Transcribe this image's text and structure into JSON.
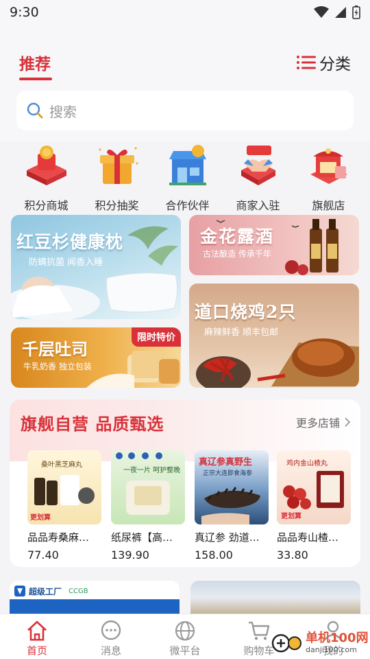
{
  "status_bar": {
    "time": "9:30"
  },
  "header": {
    "tab_label": "推荐",
    "category_label": "分类",
    "search_placeholder": "搜索"
  },
  "quick_links": [
    {
      "label": "积分商城",
      "icon": "coin-gift-icon"
    },
    {
      "label": "积分抽奖",
      "icon": "gift-box-icon"
    },
    {
      "label": "合作伙伴",
      "icon": "storefront-icon"
    },
    {
      "label": "商家入驻",
      "icon": "handshake-icon"
    },
    {
      "label": "旗舰店",
      "icon": "shop-bag-icon"
    }
  ],
  "banners": {
    "pillow": {
      "title": "红豆杉健康枕",
      "subtitle": "防螨抗菌  闻香入睡"
    },
    "wine": {
      "title": "金花露酒",
      "subtitle": "古法酿造  传承千年"
    },
    "toast": {
      "title": "千层吐司",
      "subtitle": "牛乳奶香  独立包装",
      "badge": "限时特价"
    },
    "chicken": {
      "title": "道口烧鸡2只",
      "subtitle": "麻辣鲜香  顺丰包邮"
    }
  },
  "flagship": {
    "title": "旗舰自营  品质甄选",
    "more_label": "更多店铺",
    "products": [
      {
        "name": "品品寿桑麻…",
        "price": "77.40",
        "img_text": "桑叶黑芝麻丸",
        "img_tag": "更划算"
      },
      {
        "name": "纸尿裤【高…",
        "price": "139.90",
        "img_text": "一夜一片 呵护整晚",
        "img_tag": ""
      },
      {
        "name": "真辽参 劲道…",
        "price": "158.00",
        "img_text": "真辽参真野生",
        "img_sub": "正宗大连即食海参"
      },
      {
        "name": "品品寿山楂…",
        "price": "33.80",
        "img_text": "鸡内金山楂丸",
        "img_tag": "更划算"
      }
    ]
  },
  "bottom_banners": {
    "left_brand": "超级工厂",
    "left_brand2": "CCGB"
  },
  "tabbar": [
    {
      "label": "首页",
      "icon": "home-icon",
      "active": true
    },
    {
      "label": "消息",
      "icon": "chat-bubble-icon",
      "active": false
    },
    {
      "label": "微平台",
      "icon": "globe-icon",
      "active": false
    },
    {
      "label": "购物车",
      "icon": "cart-icon",
      "active": false
    },
    {
      "label": "我的",
      "icon": "user-icon",
      "active": false
    }
  ],
  "watermark": {
    "title": "单机100网",
    "url": "danji100.com"
  },
  "colors": {
    "accent": "#d8313a",
    "page_bg": "#f4f4f6"
  }
}
